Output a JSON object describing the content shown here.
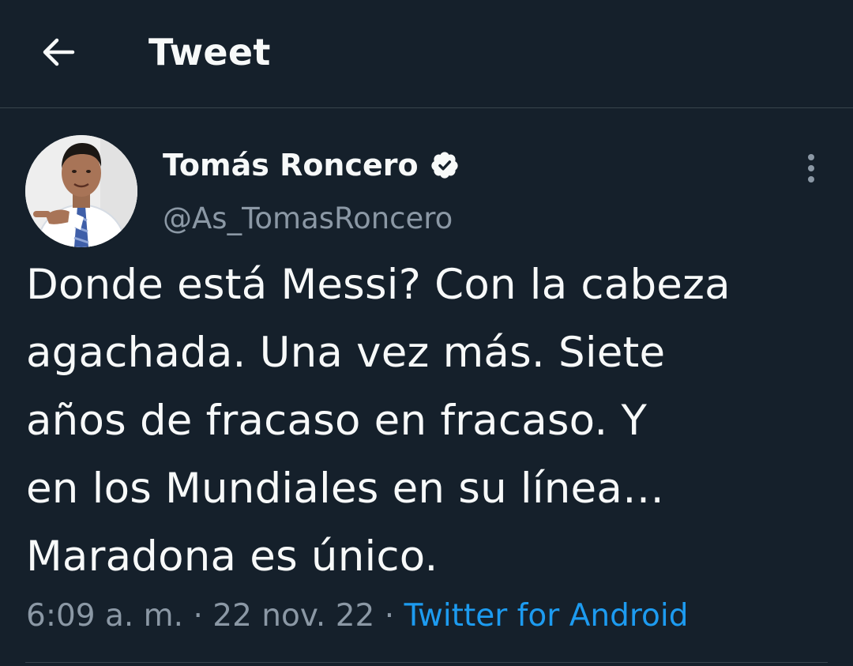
{
  "header": {
    "title": "Tweet",
    "back_icon": "arrow-left-icon"
  },
  "author": {
    "display_name": "Tomás Roncero",
    "handle": "@As_TomasRoncero",
    "verified_icon": "verified-badge-icon",
    "more_icon": "more-vertical-icon"
  },
  "tweet": {
    "lines": [
      "Donde está Messi? Con la cabeza",
      "agachada. Una vez más. Siete",
      "años de fracaso en fracaso. Y",
      "en los Mundiales en su línea…",
      "Maradona es único."
    ],
    "time": "6:09 a. m.",
    "separator1": "·",
    "date": "22 nov. 22",
    "separator2": "·",
    "source": "Twitter for Android"
  },
  "colors": {
    "background": "#15202b",
    "text": "#f7f9f9",
    "secondary": "#8b98a5",
    "link": "#1d9bf0",
    "border": "#38444d"
  }
}
